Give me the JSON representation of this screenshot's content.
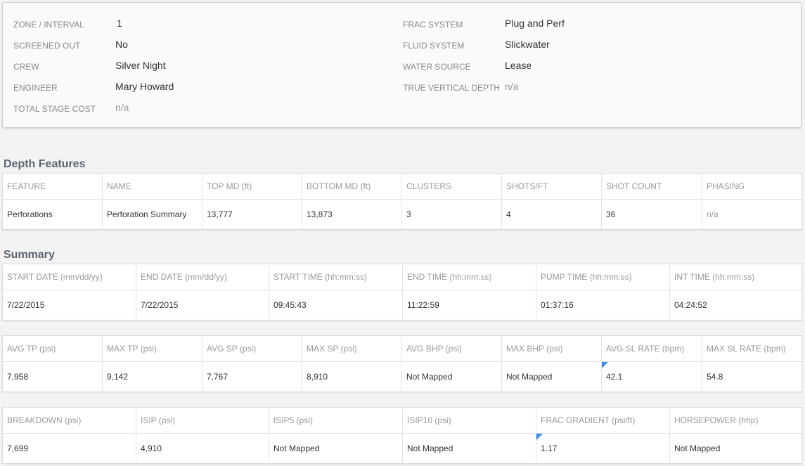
{
  "info": {
    "left": [
      {
        "label": "ZONE / INTERVAL",
        "value": "1"
      },
      {
        "label": "SCREENED OUT",
        "value": "No"
      },
      {
        "label": "CREW",
        "value": "Silver Night"
      },
      {
        "label": "ENGINEER",
        "value": "Mary Howard"
      },
      {
        "label": "TOTAL STAGE COST",
        "value": "n/a"
      }
    ],
    "right": [
      {
        "label": "FRAC SYSTEM",
        "value": "Plug and Perf"
      },
      {
        "label": "FLUID SYSTEM",
        "value": "Slickwater"
      },
      {
        "label": "WATER SOURCE",
        "value": "Lease"
      },
      {
        "label": "TRUE VERTICAL DEPTH",
        "value": "n/a"
      }
    ]
  },
  "depth_features": {
    "title": "Depth Features",
    "headers": [
      "FEATURE",
      "NAME",
      "TOP MD (ft)",
      "BOTTOM MD (ft)",
      "CLUSTERS",
      "SHOTS/FT",
      "SHOT COUNT",
      "PHASING"
    ],
    "row": [
      "Perforations",
      "Perforation Summary",
      "13,777",
      "13,873",
      "3",
      "4",
      "36",
      "n/a"
    ]
  },
  "summary": {
    "title": "Summary",
    "times": {
      "headers": [
        "START DATE (mm/dd/yy)",
        "END DATE (mm/dd/yy)",
        "START TIME (hh:mm:ss)",
        "END TIME (hh:mm:ss)",
        "PUMP TIME (hh:mm:ss)",
        "INT TIME (hh:mm:ss)"
      ],
      "row": [
        "7/22/2015",
        "7/22/2015",
        "09:45:43",
        "11:22:59",
        "01:37:16",
        "04:24:52"
      ]
    },
    "pressures": {
      "headers": [
        "AVG TP (psi)",
        "MAX TP (psi)",
        "AVG SP (psi)",
        "MAX SP (psi)",
        "AVG BHP (psi)",
        "MAX BHP (psi)",
        "AVG SL RATE (bpm)",
        "MAX SL RATE (bpm)"
      ],
      "row": [
        "7,958",
        "9,142",
        "7,767",
        "8,910",
        "Not Mapped",
        "Not Mapped",
        "42.1",
        "54.8"
      ]
    },
    "fracture": {
      "headers": [
        "BREAKDOWN (psi)",
        "ISIP (psi)",
        "ISIP5 (psi)",
        "ISIP10 (psi)",
        "FRAC GRADIENT (psi/ft)",
        "HORSEPOWER (hhp)"
      ],
      "row": [
        "7,699",
        "4,910",
        "Not Mapped",
        "Not Mapped",
        "1.17",
        "Not Mapped"
      ]
    }
  },
  "colors": {
    "flag": "#3d8ee8",
    "title": "#5a6470"
  }
}
